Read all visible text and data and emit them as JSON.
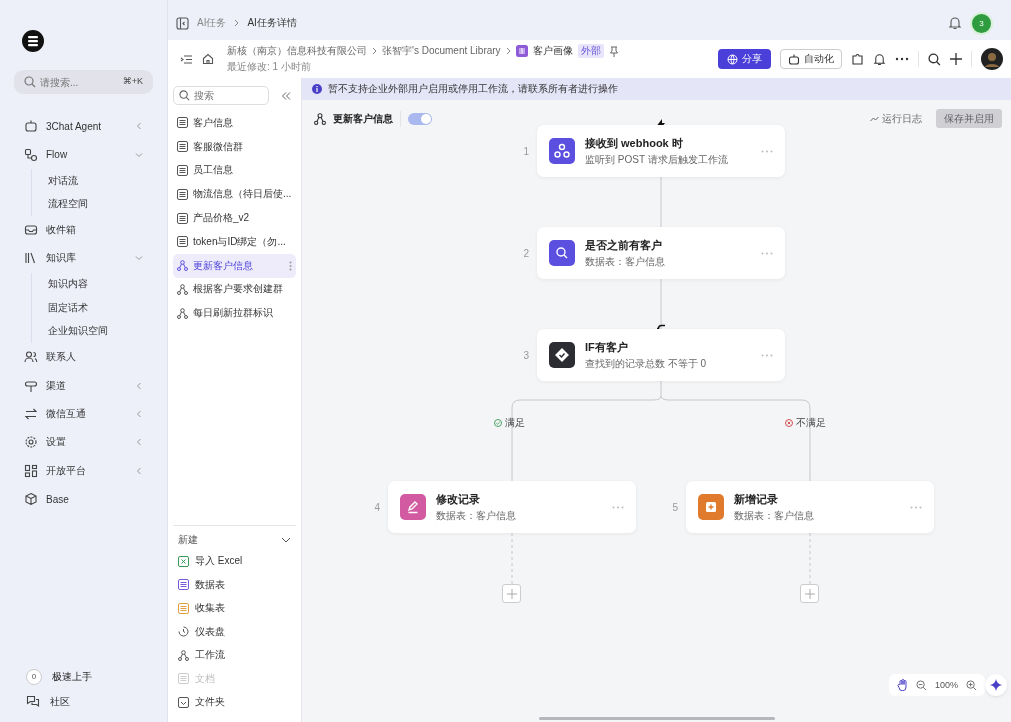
{
  "sidebar": {
    "search": {
      "placeholder": "请搜索...",
      "shortcut": "⌘+K"
    },
    "items": [
      {
        "label": "3Chat Agent",
        "expanded": false
      },
      {
        "label": "Flow",
        "expanded": true,
        "children": [
          {
            "label": "对话流"
          },
          {
            "label": "流程空间"
          }
        ]
      },
      {
        "label": "收件箱"
      },
      {
        "label": "知识库",
        "expanded": true,
        "children": [
          {
            "label": "知识内容"
          },
          {
            "label": "固定话术"
          },
          {
            "label": "企业知识空间"
          }
        ]
      },
      {
        "label": "联系人"
      },
      {
        "label": "渠道",
        "expanded": false
      },
      {
        "label": "微信互通",
        "expanded": false
      },
      {
        "label": "设置",
        "expanded": false
      },
      {
        "label": "开放平台",
        "expanded": false
      },
      {
        "label": "Base"
      }
    ],
    "footer": {
      "count": "0",
      "quick_start": "极速上手",
      "community": "社区"
    }
  },
  "topbar": {
    "breadcrumb": [
      "AI任务",
      "AI任务详情"
    ],
    "notification_count": "3"
  },
  "header": {
    "path": [
      "新核（南京）信息科技有限公司",
      "张智宇's Document Library"
    ],
    "doc_title": "客户画像",
    "doc_tag": "外部",
    "modified": "最近修改: 1 小时前",
    "share": "分享",
    "automation": "自动化"
  },
  "files": {
    "search": {
      "placeholder": "搜索"
    },
    "items": [
      {
        "label": "客户信息",
        "kind": "table",
        "selected": false
      },
      {
        "label": "客服微信群",
        "kind": "table",
        "selected": false
      },
      {
        "label": "员工信息",
        "kind": "table",
        "selected": false
      },
      {
        "label": "物流信息（待日后使...",
        "kind": "table",
        "selected": false
      },
      {
        "label": "产品价格_v2",
        "kind": "table",
        "selected": false
      },
      {
        "label": "token与ID绑定（勿...",
        "kind": "table",
        "selected": false
      },
      {
        "label": "更新客户信息",
        "kind": "workflow",
        "selected": true
      },
      {
        "label": "根据客户要求创建群",
        "kind": "workflow",
        "selected": false
      },
      {
        "label": "每日刷新拉群标识",
        "kind": "workflow",
        "selected": false
      }
    ],
    "new_section": {
      "label": "新建",
      "expanded": true,
      "items": [
        {
          "label": "导入 Excel",
          "kind": "excel",
          "disabled": false
        },
        {
          "label": "数据表",
          "kind": "table",
          "disabled": false
        },
        {
          "label": "收集表",
          "kind": "form",
          "disabled": false
        },
        {
          "label": "仪表盘",
          "kind": "dashboard",
          "disabled": false
        },
        {
          "label": "工作流",
          "kind": "workflow",
          "disabled": false
        },
        {
          "label": "文档",
          "kind": "doc",
          "disabled": true
        },
        {
          "label": "文件夹",
          "kind": "folder",
          "disabled": false
        }
      ]
    }
  },
  "banner": "暂不支持企业外部用户启用或停用工作流，请联系所有者进行操作",
  "workflow": {
    "name": "更新客户信息",
    "on": true,
    "run_log": "运行日志",
    "save_button": {
      "label": "保存并启用",
      "disabled": true
    },
    "nodes": [
      {
        "number": "1",
        "title": "接收到 webhook 时",
        "subtitle": "监听到 POST 请求后触发工作流",
        "kind": "webhook"
      },
      {
        "number": "2",
        "title": "是否之前有客户",
        "subtitle": "数据表：客户信息",
        "kind": "search"
      },
      {
        "number": "3",
        "title": "IF有客户",
        "subtitle": "查找到的记录总数 不等于 0",
        "kind": "condition"
      },
      {
        "number": "4",
        "title": "修改记录",
        "subtitle": "数据表：客户信息",
        "kind": "update"
      },
      {
        "number": "5",
        "title": "新增记录",
        "subtitle": "数据表：客户信息",
        "kind": "create"
      }
    ],
    "branches": [
      {
        "label": "满足",
        "kind": "yes"
      },
      {
        "label": "不满足",
        "kind": "no"
      }
    ],
    "zoom": "100%"
  }
}
